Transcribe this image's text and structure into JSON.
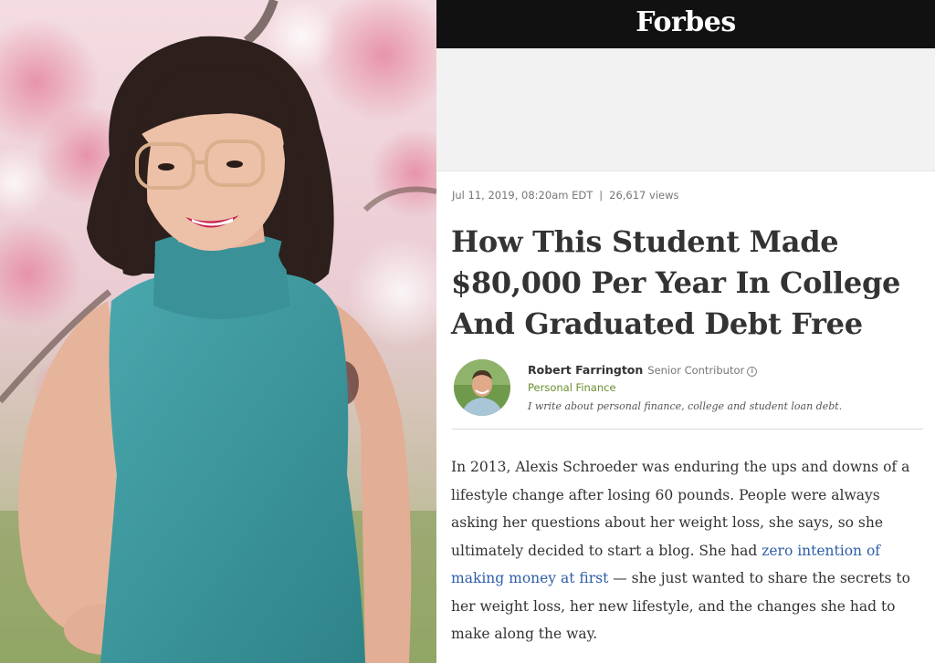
{
  "brand": {
    "logo": "Forbes"
  },
  "article": {
    "date": "Jul 11, 2019, 08:20am EDT",
    "separator": "|",
    "views": "26,617 views",
    "headline": "How This Student Made $80,000 Per Year In College And Graduated Debt Free",
    "author": {
      "name": "Robert Farrington",
      "role": "Senior Contributor",
      "topic": "Personal Finance",
      "bio": "I write about personal finance, college and student loan debt."
    },
    "body": {
      "text_before_link": "In 2013, Alexis Schroeder was enduring the ups and downs of a lifestyle change after losing 60 pounds. People were always asking her questions about her weight loss, she says, so she ultimately decided to start a blog. She had ",
      "link_text": "zero intention of making money at first",
      "text_after_link": " — she just wanted to share the secrets to her weight loss, her new lifestyle, and the changes she had to make along the way."
    }
  },
  "colors": {
    "masthead_bg": "#111111",
    "headline": "#333333",
    "link": "#2d5ea8",
    "topic": "#6a8f2e",
    "sweater": "#3f9aa0"
  },
  "icons": {
    "info": "info-circle-icon"
  }
}
